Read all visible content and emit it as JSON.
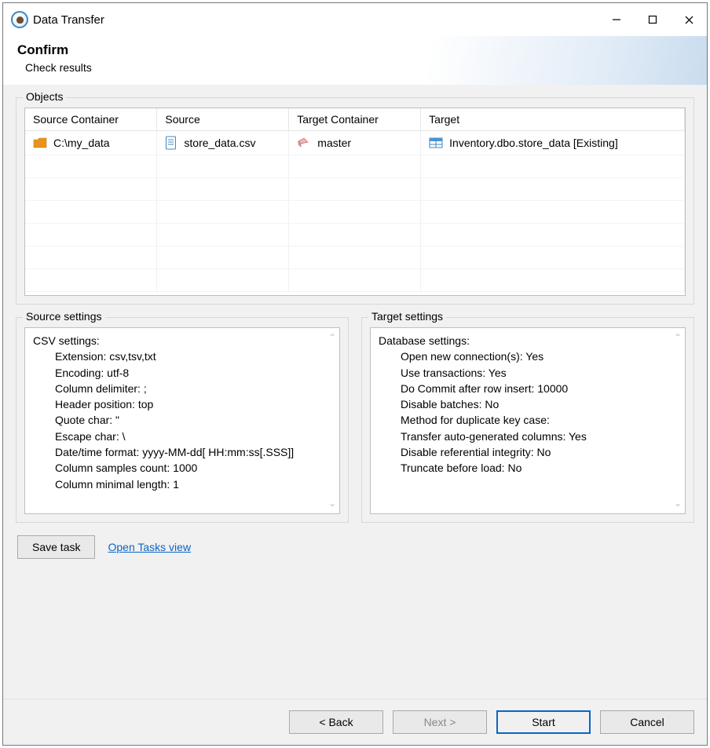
{
  "window": {
    "title": "Data Transfer"
  },
  "header": {
    "title": "Confirm",
    "subtitle": "Check results"
  },
  "objects": {
    "group_label": "Objects",
    "columns": [
      "Source Container",
      "Source",
      "Target Container",
      "Target"
    ],
    "row": {
      "source_container": "C:\\my_data",
      "source": "store_data.csv",
      "target_container": "master",
      "target": "Inventory.dbo.store_data [Existing]"
    }
  },
  "source_settings": {
    "group_label": "Source settings",
    "heading": "CSV settings:",
    "items": [
      "Extension: csv,tsv,txt",
      "Encoding: utf-8",
      "Column delimiter: ;",
      "Header position: top",
      "Quote char: \"",
      "Escape char: \\",
      "Date/time format: yyyy-MM-dd[ HH:mm:ss[.SSS]]",
      "Column samples count: 1000",
      "Column minimal length: 1"
    ]
  },
  "target_settings": {
    "group_label": "Target settings",
    "heading": "Database settings:",
    "items": [
      "Open new connection(s): Yes",
      "Use transactions: Yes",
      "Do Commit after row insert: 10000",
      "Disable batches: No",
      "Method for duplicate key case:",
      "Transfer auto-generated columns: Yes",
      "Disable referential integrity: No",
      "Truncate before load: No"
    ]
  },
  "task_row": {
    "save_task": "Save task",
    "open_tasks": "Open Tasks view"
  },
  "footer": {
    "back": "< Back",
    "next": "Next >",
    "start": "Start",
    "cancel": "Cancel"
  }
}
